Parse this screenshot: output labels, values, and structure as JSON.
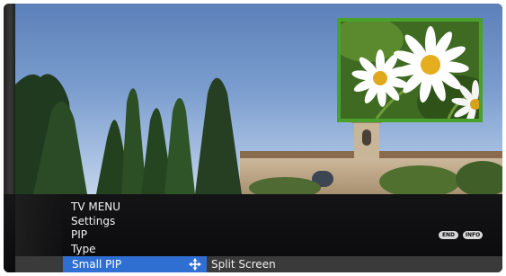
{
  "menu": {
    "breadcrumb": [
      "TV MENU",
      "Settings",
      "PIP",
      "Type"
    ],
    "selected_item": "Small PIP",
    "selected_value": "Split Screen"
  },
  "buttons": {
    "end": "END",
    "info": "INFO"
  },
  "icons": {
    "move": "four-way-arrow-icon"
  },
  "colors": {
    "highlight": "#2f6fd1",
    "pip_border": "#49a12c",
    "panel": "#141416"
  }
}
